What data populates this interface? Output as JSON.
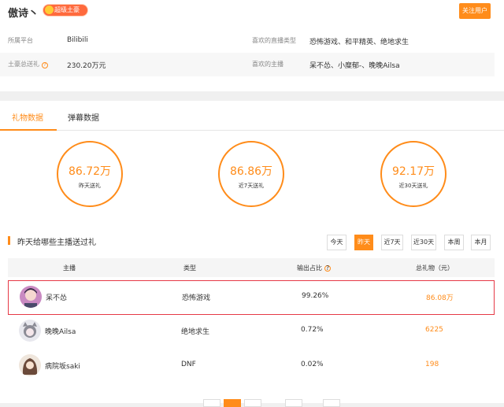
{
  "profile": {
    "username": "傲诗丶",
    "badge": "超级土豪",
    "follow_label": "关注用户",
    "rows": [
      [
        {
          "label": "所属平台",
          "value": "Bilibili"
        },
        {
          "label": "喜欢的直播类型",
          "value": "恐怖游戏、和平精英、绝地求生"
        }
      ],
      [
        {
          "label": "土豪总送礼",
          "value": "230.20万元",
          "help": "?"
        },
        {
          "label": "喜欢的主播",
          "value": "呆不怂、小糜郁-、晚晚Ailsa"
        }
      ]
    ]
  },
  "tabs": [
    {
      "label": "礼物数据",
      "active": true
    },
    {
      "label": "弹幕数据",
      "active": false
    }
  ],
  "stats": [
    {
      "value": "86.72万",
      "caption": "昨天送礼"
    },
    {
      "value": "86.86万",
      "caption": "近7天送礼"
    },
    {
      "value": "92.17万",
      "caption": "近30天送礼"
    }
  ],
  "section": {
    "title": "昨天给哪些主播送过礼",
    "ranges": [
      {
        "label": "今天",
        "active": false
      },
      {
        "label": "昨天",
        "active": true
      },
      {
        "label": "近7天",
        "active": false
      },
      {
        "label": "近30天",
        "active": false
      },
      {
        "label": "本周",
        "active": false
      },
      {
        "label": "本月",
        "active": false
      }
    ]
  },
  "table": {
    "headers": [
      "主播",
      "类型",
      "输出占比",
      "总礼物（元）"
    ],
    "ratio_help": "?",
    "rows": [
      {
        "name": "呆不怂",
        "type": "恐怖游戏",
        "ratio": "99.26%",
        "gift": "86.08万",
        "highlighted": true,
        "avatar_color": "#c98ac2"
      },
      {
        "name": "晚晚Ailsa",
        "type": "绝地求生",
        "ratio": "0.72%",
        "gift": "6225",
        "highlighted": false,
        "avatar_color": "#8b8b95"
      },
      {
        "name": "病院坂saki",
        "type": "DNF",
        "ratio": "0.02%",
        "gift": "198",
        "highlighted": false,
        "avatar_color": "#6b4a3a"
      }
    ]
  },
  "colors": {
    "accent": "#ff8c1a",
    "highlight_border": "#e63946"
  }
}
